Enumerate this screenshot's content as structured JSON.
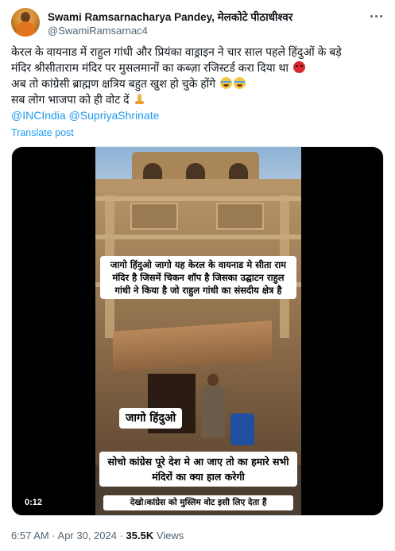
{
  "author": {
    "name": "Swami Ramsarnacharya Pandey, मेलकोटे पीठाधीश्वर",
    "handle": "@SwamiRamsarnac4"
  },
  "post": {
    "lines": [
      "केरल के वायनाड में राहुल गांधी और प्रियंका वाड्राइन ने चार साल पहले हिंदुओं के बड़े",
      "मंदिर श्रीसीताराम मंदिर पर मुसलमानों का कब्ज़ा रजिस्टर्ड करा दिया था",
      "अब तो कांग्रेसी ब्राह्मण क्षत्रिय बहुत खुश हो चुके होंगे",
      "सब लोग भाजपा को ही वोट दें"
    ],
    "mentions": "@INCIndia @SupriyaShrinate",
    "translate_label": "Translate post"
  },
  "video": {
    "caption_top": "जागो हिंदुओ जागो यह केरल के वायनाड मे सीता राम मंदिर है जिसमें चिकन शॉप है जिसका उद्घाटन राहुल गांधी ने किया है जो राहुल गांधी का संसदीय क्षेत्र है",
    "caption_middle": "जागो हिंदुओ",
    "caption_bottom": "सोचो कांग्रेस पूरे देश मे आ जाए तो का हमारे सभी मंदिरों का क्या हाल करेगी",
    "caption_footer": "देखो।कांग्रेस को मुस्लिम वोट इसी लिए देता हैं",
    "timecode": "0:12"
  },
  "meta": {
    "time": "6:57 AM · Apr 30, 2024 · ",
    "views_count": "35.5K",
    "views_label": " Views"
  },
  "icons": {
    "more": "more-horizontal-icon",
    "emoji_line2": "angry-face-emoji",
    "emoji_line3": "loudly-crying-face-emoji",
    "emoji_line4": "folded-hands-emoji"
  },
  "colors": {
    "link": "#1d9bf0",
    "secondary_text": "#536471",
    "primary_text": "#0f1419"
  }
}
